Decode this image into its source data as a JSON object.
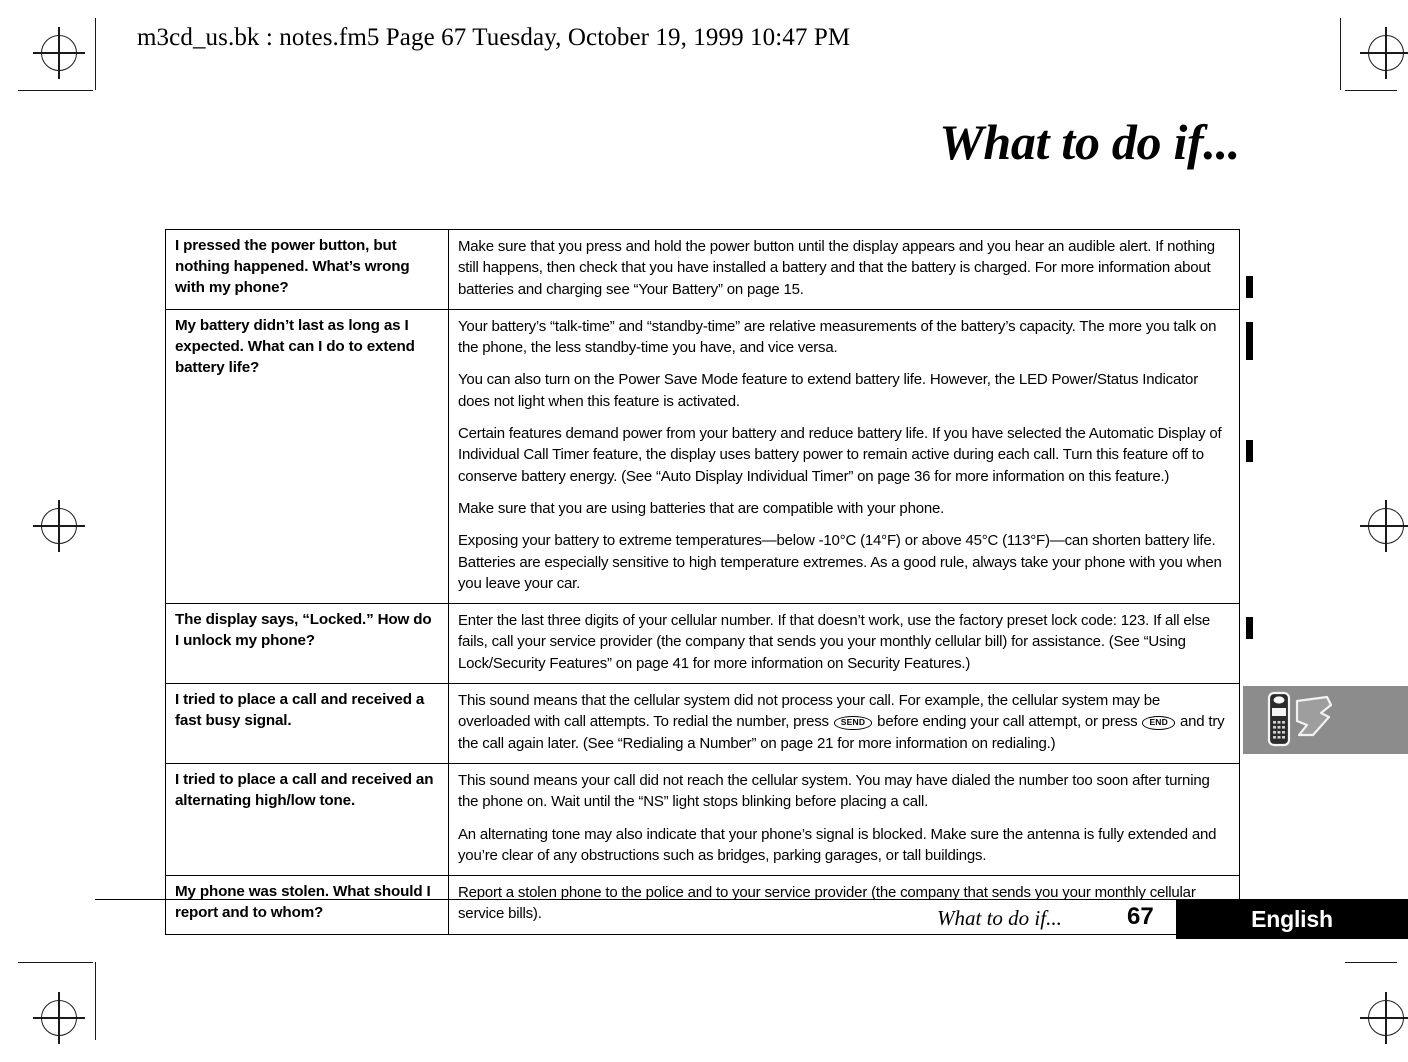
{
  "header": {
    "running_header": "m3cd_us.bk : notes.fm5  Page 67  Tuesday, October 19, 1999  10:47 PM"
  },
  "chapter": {
    "title": "What to do if..."
  },
  "table": {
    "rows": [
      {
        "question": "I pressed the power button, but nothing happened. What’s wrong with my phone?",
        "answers": [
          "Make sure that you press and hold the power button until the display appears and you hear an audible alert. If nothing still happens, then check that you have installed a battery and that the battery is charged. For more information about batteries and charging see “Your Battery” on page 15."
        ]
      },
      {
        "question": "My battery didn’t last as long as I expected. What can I do to extend battery life?",
        "answers": [
          "Your battery’s “talk-time” and “standby-time” are relative measurements of the battery’s capacity. The more you talk on the phone, the less standby-time you have, and vice versa.",
          "You can also turn on the Power Save Mode feature to extend battery life. However, the LED Power/Status Indicator does not light when this feature is activated.",
          "Certain features demand power from your battery and reduce battery life. If you have selected the Automatic Display of Individual Call Timer feature, the display uses battery power to remain active during each call. Turn this feature off to conserve battery energy. (See “Auto Display Individual Timer” on page 36 for more information on this feature.)",
          "Make sure that you are using batteries that are compatible with your phone.",
          "Exposing your battery to extreme temperatures—below -10°C (14°F) or above 45°C (113°F)—can shorten battery life. Batteries are especially sensitive to high temperature extremes. As a good rule, always take your phone with you when you leave your car."
        ]
      },
      {
        "question": "The display says, “Locked.” How do I unlock my phone?",
        "answers": [
          "Enter the last three digits of your cellular number. If that doesn’t work, use the factory preset lock code: 123. If all else fails, call your service provider (the company that sends you your monthly cellular bill) for assistance. (See “Using Lock/Security Features” on page 41 for more information on Security Features.)"
        ]
      },
      {
        "question": "I tried to place a call and received a fast busy signal.",
        "answers_rich": {
          "part1": "This sound means that the cellular system did not process your call. For example, the cellular system may be overloaded with call attempts. To redial the number, press ",
          "key1": "SEND",
          "part2": " before ending your call attempt, or press ",
          "key2": "END",
          "part3": " and try the call again later. (See “Redialing a Number” on page 21 for more information on redialing.)"
        }
      },
      {
        "question": "I tried to place a call and received an alternating high/low tone.",
        "answers": [
          "This sound means your call did not reach the cellular system. You may have dialed the number too soon after turning the phone on. Wait until the “NS” light stops blinking before placing a call.",
          "An alternating tone may also indicate that your phone’s signal is blocked. Make sure the antenna is fully extended and you’re clear of any obstructions such as bridges, parking garages, or tall buildings."
        ]
      },
      {
        "question": "My phone was stolen. What should I report and to whom?",
        "answers": [
          "Report a stolen phone to the police and to your service provider (the company that sends you your monthly cellular service bills)."
        ]
      }
    ]
  },
  "footer": {
    "chapter_title": "What to do if...",
    "page_number": "67",
    "language_tab": "English"
  },
  "colors": {
    "ink": "#000000",
    "tab_gray": "#8c8c8c",
    "paper": "#ffffff"
  }
}
